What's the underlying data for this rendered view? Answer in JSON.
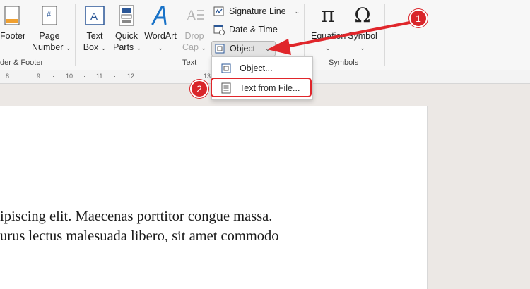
{
  "ribbon": {
    "header_footer": {
      "footer_label": "Footer",
      "page_number_label": "Page",
      "page_number_label2": "Number",
      "group_label": "der & Footer"
    },
    "text_group": {
      "text_box_label": "Text",
      "text_box_label2": "Box",
      "quick_parts_label": "Quick",
      "quick_parts_label2": "Parts",
      "wordart_label": "WordArt",
      "drop_cap_label": "Drop",
      "drop_cap_label2": "Cap",
      "signature_line_label": "Signature Line",
      "date_time_label": "Date & Time",
      "object_label": "Object",
      "group_label": "Text"
    },
    "symbols_group": {
      "equation_label": "Equation",
      "symbol_label": "Symbol",
      "group_label": "Symbols"
    }
  },
  "ruler": {
    "marks": [
      "8",
      "·",
      "9",
      "·",
      "10",
      "·",
      "11",
      "·",
      "12",
      "·",
      "13",
      "·"
    ]
  },
  "object_menu": {
    "items": [
      {
        "label": "Object..."
      },
      {
        "label": "Text from File..."
      }
    ]
  },
  "annotations": {
    "badge1": "1",
    "badge2": "2"
  },
  "document": {
    "line1": "ipiscing elit. Maecenas porttitor congue massa.",
    "line2": "urus lectus malesuada libero, sit amet commodo"
  },
  "colors": {
    "accent_red": "#e0262b",
    "ribbon_bg": "#f7f7f7",
    "canvas_bg": "#ece8e5",
    "icon_blue": "#2b5797"
  }
}
